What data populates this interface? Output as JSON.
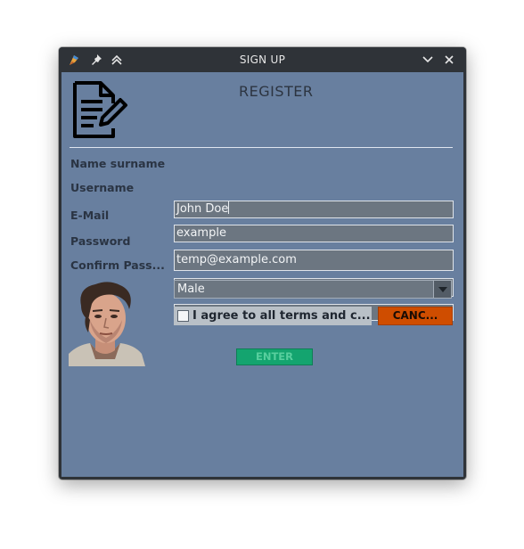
{
  "window": {
    "title": "SIGN UP"
  },
  "titlebar": {
    "icons": [
      "app-logo-icon",
      "pin-icon",
      "double-chevron-up-icon",
      "minimize-chevron-icon",
      "close-icon"
    ]
  },
  "form": {
    "heading": "REGISTER",
    "fields": [
      {
        "label": "Name surname",
        "value": "John Doe"
      },
      {
        "label": "Username",
        "value": "example"
      },
      {
        "label": "E-Mail",
        "value": "temp@example.com"
      },
      {
        "label": "Password",
        "value": "••••••••"
      },
      {
        "label": "Confirm Pass...",
        "value": "••••••••"
      }
    ],
    "gender": {
      "selected": "Male"
    },
    "terms_label": "I agree to all terms and c...",
    "cancel_label": "CANC...",
    "enter_label": "ENTER"
  },
  "colors": {
    "panel": "#687f9f",
    "cancel": "#cf4d00",
    "enter": "#14a46f"
  }
}
